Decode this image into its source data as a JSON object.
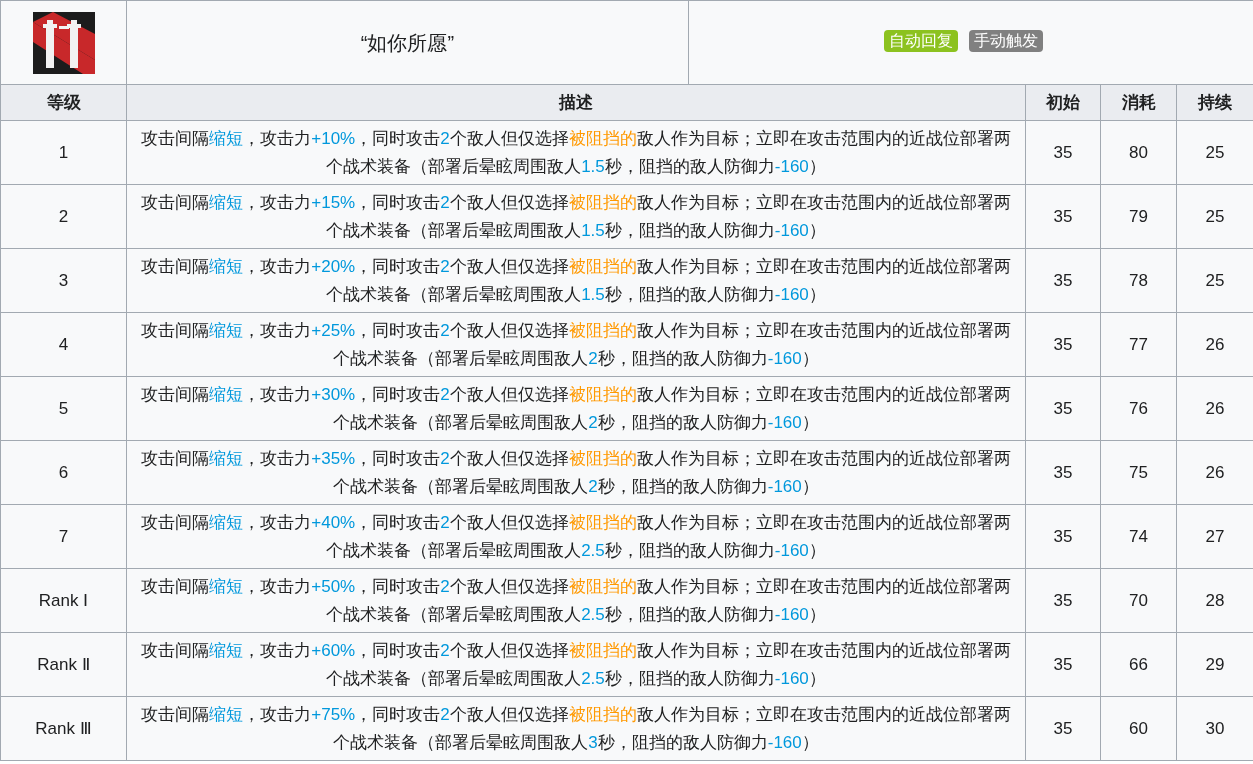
{
  "skill": {
    "name": "“如你所愿”",
    "tags": [
      {
        "label": "自动回复",
        "color": "#8cc21f"
      },
      {
        "label": "手动触发",
        "color": "#808080"
      }
    ]
  },
  "table": {
    "columns": [
      "等级",
      "描述",
      "初始",
      "消耗",
      "持续"
    ],
    "rows": [
      {
        "level": "1",
        "description": [
          {
            "kind": "plain",
            "text": "攻击间隔"
          },
          {
            "kind": "value",
            "text": "缩短"
          },
          {
            "kind": "plain",
            "text": "，攻击力"
          },
          {
            "kind": "value",
            "text": "+10%"
          },
          {
            "kind": "plain",
            "text": "，同时攻击"
          },
          {
            "kind": "value",
            "text": "2"
          },
          {
            "kind": "plain",
            "text": "个敌人但仅选择"
          },
          {
            "kind": "keyword",
            "text": "被阻挡的"
          },
          {
            "kind": "plain",
            "text": "敌人作为目标；立即在攻击范围内的近战位部署两个战术装备（部署后晕眩周围敌人"
          },
          {
            "kind": "value",
            "text": "1.5"
          },
          {
            "kind": "plain",
            "text": "秒，阻挡的敌人防御力"
          },
          {
            "kind": "value",
            "text": "-160"
          },
          {
            "kind": "plain",
            "text": "）"
          }
        ],
        "initial": "35",
        "cost": "80",
        "duration": "25"
      },
      {
        "level": "2",
        "description": [
          {
            "kind": "plain",
            "text": "攻击间隔"
          },
          {
            "kind": "value",
            "text": "缩短"
          },
          {
            "kind": "plain",
            "text": "，攻击力"
          },
          {
            "kind": "value",
            "text": "+15%"
          },
          {
            "kind": "plain",
            "text": "，同时攻击"
          },
          {
            "kind": "value",
            "text": "2"
          },
          {
            "kind": "plain",
            "text": "个敌人但仅选择"
          },
          {
            "kind": "keyword",
            "text": "被阻挡的"
          },
          {
            "kind": "plain",
            "text": "敌人作为目标；立即在攻击范围内的近战位部署两个战术装备（部署后晕眩周围敌人"
          },
          {
            "kind": "value",
            "text": "1.5"
          },
          {
            "kind": "plain",
            "text": "秒，阻挡的敌人防御力"
          },
          {
            "kind": "value",
            "text": "-160"
          },
          {
            "kind": "plain",
            "text": "）"
          }
        ],
        "initial": "35",
        "cost": "79",
        "duration": "25"
      },
      {
        "level": "3",
        "description": [
          {
            "kind": "plain",
            "text": "攻击间隔"
          },
          {
            "kind": "value",
            "text": "缩短"
          },
          {
            "kind": "plain",
            "text": "，攻击力"
          },
          {
            "kind": "value",
            "text": "+20%"
          },
          {
            "kind": "plain",
            "text": "，同时攻击"
          },
          {
            "kind": "value",
            "text": "2"
          },
          {
            "kind": "plain",
            "text": "个敌人但仅选择"
          },
          {
            "kind": "keyword",
            "text": "被阻挡的"
          },
          {
            "kind": "plain",
            "text": "敌人作为目标；立即在攻击范围内的近战位部署两个战术装备（部署后晕眩周围敌人"
          },
          {
            "kind": "value",
            "text": "1.5"
          },
          {
            "kind": "plain",
            "text": "秒，阻挡的敌人防御力"
          },
          {
            "kind": "value",
            "text": "-160"
          },
          {
            "kind": "plain",
            "text": "）"
          }
        ],
        "initial": "35",
        "cost": "78",
        "duration": "25"
      },
      {
        "level": "4",
        "description": [
          {
            "kind": "plain",
            "text": "攻击间隔"
          },
          {
            "kind": "value",
            "text": "缩短"
          },
          {
            "kind": "plain",
            "text": "，攻击力"
          },
          {
            "kind": "value",
            "text": "+25%"
          },
          {
            "kind": "plain",
            "text": "，同时攻击"
          },
          {
            "kind": "value",
            "text": "2"
          },
          {
            "kind": "plain",
            "text": "个敌人但仅选择"
          },
          {
            "kind": "keyword",
            "text": "被阻挡的"
          },
          {
            "kind": "plain",
            "text": "敌人作为目标；立即在攻击范围内的近战位部署两个战术装备（部署后晕眩周围敌人"
          },
          {
            "kind": "value",
            "text": "2"
          },
          {
            "kind": "plain",
            "text": "秒，阻挡的敌人防御力"
          },
          {
            "kind": "value",
            "text": "-160"
          },
          {
            "kind": "plain",
            "text": "）"
          }
        ],
        "initial": "35",
        "cost": "77",
        "duration": "26"
      },
      {
        "level": "5",
        "description": [
          {
            "kind": "plain",
            "text": "攻击间隔"
          },
          {
            "kind": "value",
            "text": "缩短"
          },
          {
            "kind": "plain",
            "text": "，攻击力"
          },
          {
            "kind": "value",
            "text": "+30%"
          },
          {
            "kind": "plain",
            "text": "，同时攻击"
          },
          {
            "kind": "value",
            "text": "2"
          },
          {
            "kind": "plain",
            "text": "个敌人但仅选择"
          },
          {
            "kind": "keyword",
            "text": "被阻挡的"
          },
          {
            "kind": "plain",
            "text": "敌人作为目标；立即在攻击范围内的近战位部署两个战术装备（部署后晕眩周围敌人"
          },
          {
            "kind": "value",
            "text": "2"
          },
          {
            "kind": "plain",
            "text": "秒，阻挡的敌人防御力"
          },
          {
            "kind": "value",
            "text": "-160"
          },
          {
            "kind": "plain",
            "text": "）"
          }
        ],
        "initial": "35",
        "cost": "76",
        "duration": "26"
      },
      {
        "level": "6",
        "description": [
          {
            "kind": "plain",
            "text": "攻击间隔"
          },
          {
            "kind": "value",
            "text": "缩短"
          },
          {
            "kind": "plain",
            "text": "，攻击力"
          },
          {
            "kind": "value",
            "text": "+35%"
          },
          {
            "kind": "plain",
            "text": "，同时攻击"
          },
          {
            "kind": "value",
            "text": "2"
          },
          {
            "kind": "plain",
            "text": "个敌人但仅选择"
          },
          {
            "kind": "keyword",
            "text": "被阻挡的"
          },
          {
            "kind": "plain",
            "text": "敌人作为目标；立即在攻击范围内的近战位部署两个战术装备（部署后晕眩周围敌人"
          },
          {
            "kind": "value",
            "text": "2"
          },
          {
            "kind": "plain",
            "text": "秒，阻挡的敌人防御力"
          },
          {
            "kind": "value",
            "text": "-160"
          },
          {
            "kind": "plain",
            "text": "）"
          }
        ],
        "initial": "35",
        "cost": "75",
        "duration": "26"
      },
      {
        "level": "7",
        "description": [
          {
            "kind": "plain",
            "text": "攻击间隔"
          },
          {
            "kind": "value",
            "text": "缩短"
          },
          {
            "kind": "plain",
            "text": "，攻击力"
          },
          {
            "kind": "value",
            "text": "+40%"
          },
          {
            "kind": "plain",
            "text": "，同时攻击"
          },
          {
            "kind": "value",
            "text": "2"
          },
          {
            "kind": "plain",
            "text": "个敌人但仅选择"
          },
          {
            "kind": "keyword",
            "text": "被阻挡的"
          },
          {
            "kind": "plain",
            "text": "敌人作为目标；立即在攻击范围内的近战位部署两个战术装备（部署后晕眩周围敌人"
          },
          {
            "kind": "value",
            "text": "2.5"
          },
          {
            "kind": "plain",
            "text": "秒，阻挡的敌人防御力"
          },
          {
            "kind": "value",
            "text": "-160"
          },
          {
            "kind": "plain",
            "text": "）"
          }
        ],
        "initial": "35",
        "cost": "74",
        "duration": "27"
      },
      {
        "level": "Rank Ⅰ",
        "description": [
          {
            "kind": "plain",
            "text": "攻击间隔"
          },
          {
            "kind": "value",
            "text": "缩短"
          },
          {
            "kind": "plain",
            "text": "，攻击力"
          },
          {
            "kind": "value",
            "text": "+50%"
          },
          {
            "kind": "plain",
            "text": "，同时攻击"
          },
          {
            "kind": "value",
            "text": "2"
          },
          {
            "kind": "plain",
            "text": "个敌人但仅选择"
          },
          {
            "kind": "keyword",
            "text": "被阻挡的"
          },
          {
            "kind": "plain",
            "text": "敌人作为目标；立即在攻击范围内的近战位部署两个战术装备（部署后晕眩周围敌人"
          },
          {
            "kind": "value",
            "text": "2.5"
          },
          {
            "kind": "plain",
            "text": "秒，阻挡的敌人防御力"
          },
          {
            "kind": "value",
            "text": "-160"
          },
          {
            "kind": "plain",
            "text": "）"
          }
        ],
        "initial": "35",
        "cost": "70",
        "duration": "28"
      },
      {
        "level": "Rank Ⅱ",
        "description": [
          {
            "kind": "plain",
            "text": "攻击间隔"
          },
          {
            "kind": "value",
            "text": "缩短"
          },
          {
            "kind": "plain",
            "text": "，攻击力"
          },
          {
            "kind": "value",
            "text": "+60%"
          },
          {
            "kind": "plain",
            "text": "，同时攻击"
          },
          {
            "kind": "value",
            "text": "2"
          },
          {
            "kind": "plain",
            "text": "个敌人但仅选择"
          },
          {
            "kind": "keyword",
            "text": "被阻挡的"
          },
          {
            "kind": "plain",
            "text": "敌人作为目标；立即在攻击范围内的近战位部署两个战术装备（部署后晕眩周围敌人"
          },
          {
            "kind": "value",
            "text": "2.5"
          },
          {
            "kind": "plain",
            "text": "秒，阻挡的敌人防御力"
          },
          {
            "kind": "value",
            "text": "-160"
          },
          {
            "kind": "plain",
            "text": "）"
          }
        ],
        "initial": "35",
        "cost": "66",
        "duration": "29"
      },
      {
        "level": "Rank Ⅲ",
        "description": [
          {
            "kind": "plain",
            "text": "攻击间隔"
          },
          {
            "kind": "value",
            "text": "缩短"
          },
          {
            "kind": "plain",
            "text": "，攻击力"
          },
          {
            "kind": "value",
            "text": "+75%"
          },
          {
            "kind": "plain",
            "text": "，同时攻击"
          },
          {
            "kind": "value",
            "text": "2"
          },
          {
            "kind": "plain",
            "text": "个敌人但仅选择"
          },
          {
            "kind": "keyword",
            "text": "被阻挡的"
          },
          {
            "kind": "plain",
            "text": "敌人作为目标；立即在攻击范围内的近战位部署两个战术装备（部署后晕眩周围敌人"
          },
          {
            "kind": "value",
            "text": "3"
          },
          {
            "kind": "plain",
            "text": "秒，阻挡的敌人防御力"
          },
          {
            "kind": "value",
            "text": "-160"
          },
          {
            "kind": "plain",
            "text": "）"
          }
        ],
        "initial": "35",
        "cost": "60",
        "duration": "30"
      }
    ]
  }
}
